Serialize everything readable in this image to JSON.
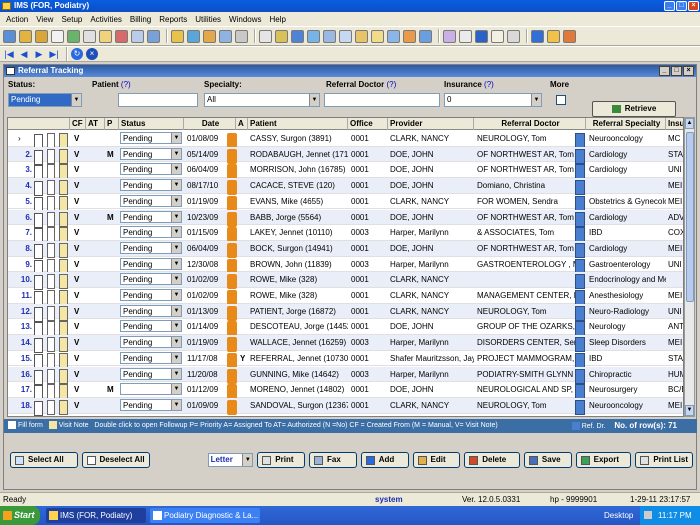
{
  "app": {
    "title": "IMS (FOR, Podiatry)",
    "menus": [
      "Action",
      "View",
      "Setup",
      "Activities",
      "Billing",
      "Reports",
      "Utilities",
      "Windows",
      "Help"
    ]
  },
  "child_window": {
    "title": "Referral Tracking"
  },
  "filters": {
    "status_label": "Status:",
    "status_value": "Pending",
    "patient_label": "Patient",
    "patient_help": "(?)",
    "patient_value": "",
    "specialty_label": "Specialty:",
    "specialty_value": "All",
    "referral_doctor_label": "Referral Doctor",
    "referral_doctor_help": "(?)",
    "referral_doctor_value": "",
    "insurance_label": "Insurance",
    "insurance_help": "(?)",
    "insurance_value": "0",
    "more_label": "More",
    "retrieve_label": "Retrieve"
  },
  "grid": {
    "columns": [
      "CF",
      "AT",
      "P",
      "Status",
      "Date",
      "A",
      "Patient",
      "Office",
      "Provider",
      "Referral Doctor",
      "Referral Specialty",
      "Insu"
    ],
    "rows": [
      {
        "num": "1.",
        "cf": "V",
        "at": "",
        "p": "",
        "status": "Pending",
        "date": "01/08/09",
        "a": "",
        "patient": "CASSY, Surgon (3891)",
        "office": "0001",
        "provider": "CLARK, NANCY",
        "ref_doctor": "NEUROLOGY, Tom",
        "specialty": "Neurooncology",
        "ins": "MC F"
      },
      {
        "num": "2.",
        "cf": "V",
        "at": "",
        "p": "M",
        "status": "Pending",
        "date": "05/14/09",
        "a": "",
        "patient": "RODABAUGH, Jennet (1716(",
        "office": "0001",
        "provider": "DOE, JOHN",
        "ref_doctor": "OF NORTHWEST AR, Tom",
        "specialty": "Cardiology",
        "ins": "STA"
      },
      {
        "num": "3.",
        "cf": "V",
        "at": "",
        "p": "",
        "status": "Pending",
        "date": "06/04/09",
        "a": "",
        "patient": "MORRISON, John (16785)",
        "office": "0001",
        "provider": "DOE, JOHN",
        "ref_doctor": "OF NORTHWEST AR, Tom",
        "specialty": "Cardiology",
        "ins": "UNI"
      },
      {
        "num": "4.",
        "cf": "V",
        "at": "",
        "p": "",
        "status": "Pending",
        "date": "08/17/10",
        "a": "",
        "patient": "CACACE, STEVE (120)",
        "office": "0001",
        "provider": "DOE, JOHN",
        "ref_doctor": "Domiano, Christina",
        "specialty": "",
        "ins": "MEI"
      },
      {
        "num": "5.",
        "cf": "V",
        "at": "",
        "p": "",
        "status": "Pending",
        "date": "01/19/09",
        "a": "",
        "patient": "EVANS, Mike (4655)",
        "office": "0001",
        "provider": "CLARK, NANCY",
        "ref_doctor": "FOR WOMEN, Sendra",
        "specialty": "Obstetrics & Gynecology",
        "ins": "MEI"
      },
      {
        "num": "6.",
        "cf": "V",
        "at": "",
        "p": "M",
        "status": "Pending",
        "date": "10/23/09",
        "a": "",
        "patient": "BABB, Jorge (5564)",
        "office": "0001",
        "provider": "DOE, JOHN",
        "ref_doctor": "OF NORTHWEST AR, Tom",
        "specialty": "Cardiology",
        "ins": "ADV"
      },
      {
        "num": "7.",
        "cf": "V",
        "at": "",
        "p": "",
        "status": "Pending",
        "date": "01/15/09",
        "a": "",
        "patient": "LAKEY, Jennet (10110)",
        "office": "0003",
        "provider": "Harper, Marilynn",
        "ref_doctor": "& ASSOCIATES, Tom",
        "specialty": "IBD",
        "ins": "COX"
      },
      {
        "num": "8.",
        "cf": "V",
        "at": "",
        "p": "",
        "status": "Pending",
        "date": "06/04/09",
        "a": "",
        "patient": "BOCK, Surgon (14941)",
        "office": "0001",
        "provider": "DOE, JOHN",
        "ref_doctor": "OF NORTHWEST AR, Tom",
        "specialty": "Cardiology",
        "ins": "MEI"
      },
      {
        "num": "9.",
        "cf": "V",
        "at": "",
        "p": "",
        "status": "Pending",
        "date": "12/30/08",
        "a": "",
        "patient": "BROWN, John (11839)",
        "office": "0003",
        "provider": "Harper, Marilynn",
        "ref_doctor": "GASTROENTEROLOGY , M",
        "specialty": "Gastroenterology",
        "ins": "UNI"
      },
      {
        "num": "10.",
        "cf": "V",
        "at": "",
        "p": "",
        "status": "Pending",
        "date": "01/02/09",
        "a": "",
        "patient": "ROWE, Mike (328)",
        "office": "0001",
        "provider": "CLARK, NANCY",
        "ref_doctor": "",
        "specialty": "Endocrinology and Metab",
        "ins": ""
      },
      {
        "num": "11.",
        "cf": "V",
        "at": "",
        "p": "",
        "status": "Pending",
        "date": "01/02/09",
        "a": "",
        "patient": "ROWE, Mike (328)",
        "office": "0001",
        "provider": "CLARK, NANCY",
        "ref_doctor": "MANAGEMENT CENTER, M",
        "specialty": "Anesthesiology",
        "ins": "MEI"
      },
      {
        "num": "12.",
        "cf": "V",
        "at": "",
        "p": "",
        "status": "Pending",
        "date": "01/13/09",
        "a": "",
        "patient": "PATIENT, Jorge (16872)",
        "office": "0001",
        "provider": "CLARK, NANCY",
        "ref_doctor": "NEUROLOGY, Tom",
        "specialty": "Neuro-Radiology",
        "ins": "UNI"
      },
      {
        "num": "13.",
        "cf": "V",
        "at": "",
        "p": "",
        "status": "Pending",
        "date": "01/14/09",
        "a": "",
        "patient": "DESCOTEAU, Jorge (14452)",
        "office": "0001",
        "provider": "DOE, JOHN",
        "ref_doctor": "GROUP OF THE OZARKS, .",
        "specialty": "Neurology",
        "ins": "ANT"
      },
      {
        "num": "14.",
        "cf": "V",
        "at": "",
        "p": "",
        "status": "Pending",
        "date": "01/19/09",
        "a": "",
        "patient": "WALLACE, Jennet (16259)",
        "office": "0003",
        "provider": "Harper, Marilynn",
        "ref_doctor": "DISORDERS CENTER, Sen",
        "specialty": "Sleep Disorders",
        "ins": "MEI"
      },
      {
        "num": "15.",
        "cf": "V",
        "at": "",
        "p": "",
        "status": "Pending",
        "date": "11/17/08",
        "a": "Y",
        "patient": "REFERRAL, Jennet (10730)",
        "office": "0001",
        "provider": "Shafer Mauritzsson, Jay",
        "ref_doctor": "PROJECT MAMMOGRAM, J",
        "specialty": "IBD",
        "ins": "STA"
      },
      {
        "num": "16.",
        "cf": "V",
        "at": "",
        "p": "",
        "status": "Pending",
        "date": "11/20/08",
        "a": "",
        "patient": "GUNNING, Mike (14642)",
        "office": "0003",
        "provider": "Harper, Marilynn",
        "ref_doctor": "PODIATRY-SMITH GLYNN (",
        "specialty": "Chiropractic",
        "ins": "HUM"
      },
      {
        "num": "17.",
        "cf": "V",
        "at": "",
        "p": "M",
        "status": "",
        "date": "01/12/09",
        "a": "",
        "patient": "MORENO, Jennet (14802)",
        "office": "0001",
        "provider": "DOE, JOHN",
        "ref_doctor": "NEUROLOGICAL AND SP, I",
        "specialty": "Neurosurgery",
        "ins": "BC/E"
      },
      {
        "num": "18.",
        "cf": "V",
        "at": "",
        "p": "",
        "status": "Pending",
        "date": "01/09/09",
        "a": "",
        "patient": "SANDOVAL, Surgon (12367)",
        "office": "0001",
        "provider": "CLARK, NANCY",
        "ref_doctor": "NEUROLOGY, Tom",
        "specialty": "Neurooncology",
        "ins": "MEI"
      }
    ]
  },
  "legend": {
    "fill_form": "Fill form",
    "visit_note": "Visit Note",
    "help_text": "Double click to open Followup  P= Priority  A= Assigned To  AT= Authorized (N =No)  CF = Created From (M = Manual, V= Visit Note)",
    "ref_dr": "Ref. Dr.",
    "row_count_label": "No. of row(s):",
    "row_count": "71"
  },
  "buttons": {
    "select_all": "Select All",
    "deselect_all": "Deselect All",
    "paper": "Letter",
    "print": "Print",
    "fax": "Fax",
    "add": "Add",
    "edit": "Edit",
    "delete": "Delete",
    "save": "Save",
    "export": "Export",
    "print_list": "Print List"
  },
  "statusbar": {
    "state": "Ready",
    "user": "system",
    "version": "Ver. 12.0.5.0331",
    "host": "hp - 9999901",
    "datetime": "1-29-11 23:17:57"
  },
  "taskbar": {
    "start": "Start",
    "task1": "IMS (FOR, Podiatry)",
    "task2": "Podiatry Diagnostic & La...",
    "desktop": "Desktop",
    "clock": "11:17 PM"
  },
  "colors": {
    "title_blue": "#0a5ee0",
    "row_num_blue": "#1f2fb0",
    "legend_bar": "#3a6ea5"
  }
}
